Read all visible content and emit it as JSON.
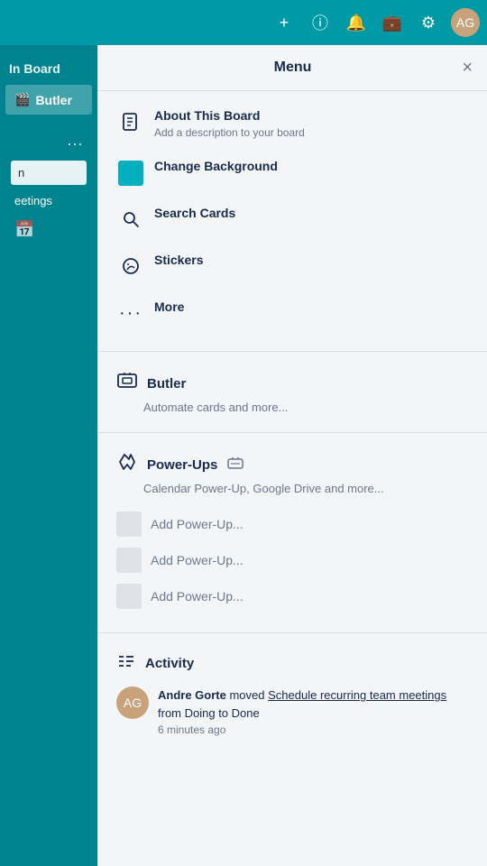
{
  "topbar": {
    "icons": [
      {
        "name": "plus-icon",
        "symbol": "+"
      },
      {
        "name": "info-icon",
        "symbol": "ℹ"
      },
      {
        "name": "bell-icon",
        "symbol": "🔔"
      },
      {
        "name": "briefcase-icon",
        "symbol": "💼"
      },
      {
        "name": "gear-icon",
        "symbol": "⚙"
      }
    ],
    "avatar_text": "AG"
  },
  "sidebar": {
    "board_label": "In Board",
    "butler_label": "Butler",
    "search_placeholder": "n",
    "meetings_label": "eetings",
    "ellipsis": "···"
  },
  "menu": {
    "title": "Menu",
    "close_symbol": "×",
    "items": [
      {
        "id": "about",
        "icon_symbol": "📋",
        "title": "About This Board",
        "desc": "Add a description to your board"
      },
      {
        "id": "background",
        "icon_symbol": "color",
        "title": "Change Background",
        "desc": ""
      },
      {
        "id": "search",
        "icon_symbol": "🔍",
        "title": "Search Cards",
        "desc": ""
      },
      {
        "id": "stickers",
        "icon_symbol": "🏷",
        "title": "Stickers",
        "desc": ""
      },
      {
        "id": "more",
        "icon_symbol": "···",
        "title": "More",
        "desc": ""
      }
    ],
    "butler": {
      "title": "Butler",
      "desc": "Automate cards and more...",
      "icon_symbol": "🎬"
    },
    "powerups": {
      "title": "Power-Ups",
      "badge_symbol": "📦",
      "desc": "Calendar Power-Up, Google Drive and more...",
      "add_items": [
        "Add Power-Up...",
        "Add Power-Up...",
        "Add Power-Up..."
      ]
    },
    "activity": {
      "title": "Activity",
      "icon_symbol": "≡",
      "item": {
        "user": "Andre Gorte",
        "action": "moved",
        "card_link": "Schedule recurring team meetings",
        "from": "from Doing to Done",
        "time": "6 minutes ago",
        "avatar_text": "AG"
      }
    }
  }
}
